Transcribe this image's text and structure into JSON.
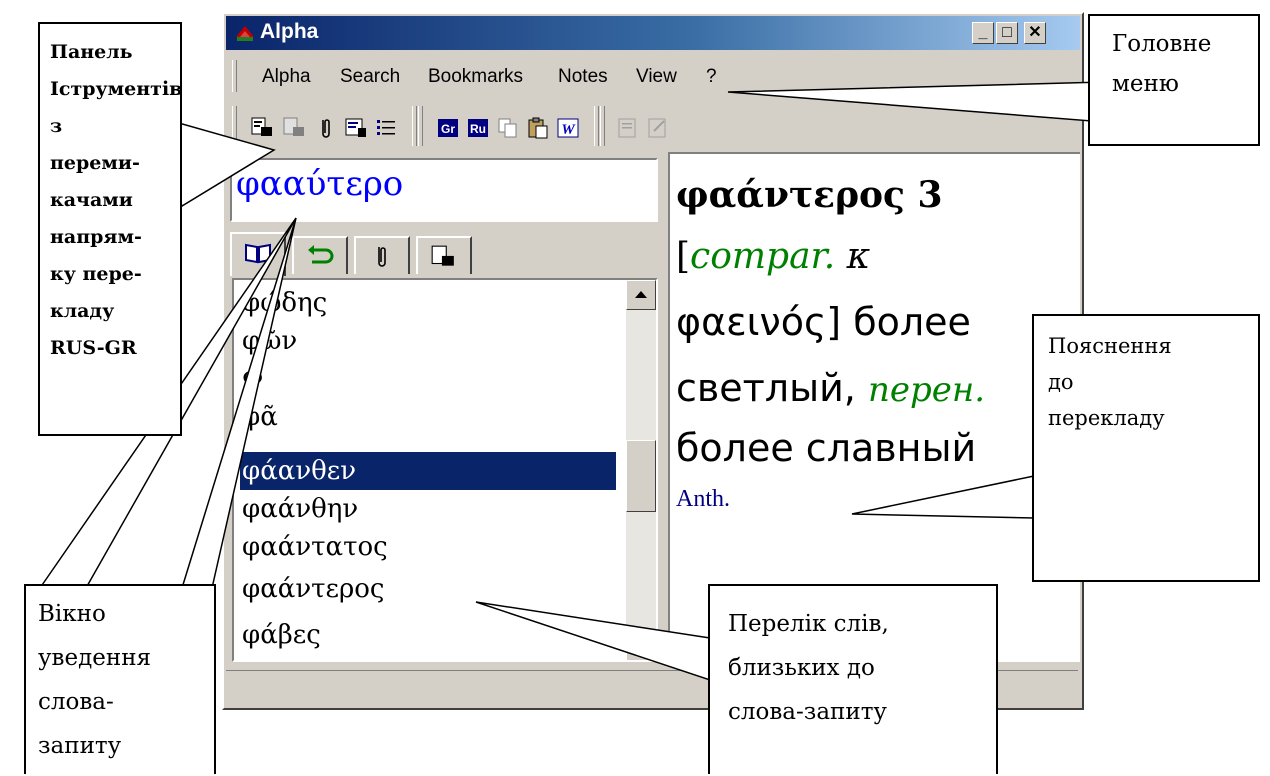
{
  "window": {
    "title": "Alpha",
    "controls": [
      "_",
      "□",
      "✕"
    ]
  },
  "menu": [
    "Alpha",
    "Search",
    "Bookmarks",
    "Notes",
    "View",
    "?"
  ],
  "toolbar": {
    "icons": [
      "find-icon",
      "find-disabled-icon",
      "paperclip-icon",
      "search-list-icon",
      "list-icon",
      "greek-gr-icon",
      "russian-ru-icon",
      "copy-icon",
      "paste-icon",
      "word-w-icon",
      "note-icon",
      "note-edit-icon"
    ],
    "gr_label": "Gr",
    "ru_label": "Ru",
    "w_label": "W"
  },
  "search": {
    "value": "φααύτερο"
  },
  "tabs": [
    "book-icon",
    "back-arrow-icon",
    "paperclip-icon",
    "find-icon"
  ],
  "word_list": {
    "items": [
      "φώδης",
      "φῶν",
      "Φ",
      "φᾶ",
      "φάανθεν",
      "φαάνθην",
      "φαάντατος",
      "φαάντερος",
      "φάβες"
    ],
    "selected_index": 4
  },
  "article": {
    "headword": "φαάντερος 3",
    "line1_bracket": "[",
    "line1_italic": "compar.",
    "line1_rest": " κ",
    "line2": "φαεινός] более",
    "line3_plain": "светлый, ",
    "line3_italic": "перен.",
    "line4": "более славный",
    "source": "Anth.",
    "colors": {
      "headword": "#000000",
      "italic_green": "#008000",
      "source": "#000080"
    }
  },
  "callouts": {
    "toolbar": "Панель\nІструментів з\nпереми-\nкачами\nнапрям-\nку пере-\nкладу\nRUS-GR",
    "menu": "Головне\nменю",
    "explanation": "Пояснення\nдо\nперекладу",
    "input": "Вікно\nуведення\nслова-\nзапиту",
    "wordlist": "Перелік слів,\nблизьких до\nслова-запиту"
  }
}
